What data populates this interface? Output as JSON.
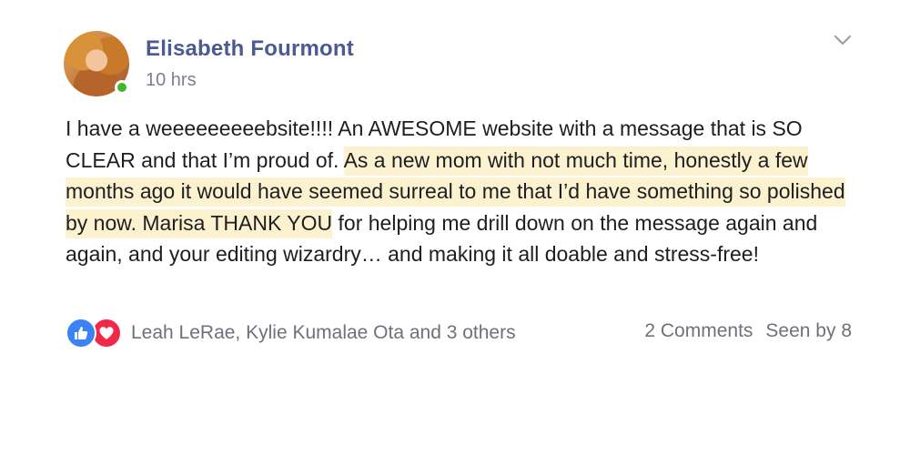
{
  "post": {
    "author": "Elisabeth Fourmont",
    "timestamp": "10 hrs",
    "online": true,
    "text_part1": "I have a weeeeeeeeebsite!!!! An AWESOME website with a message that is SO CLEAR and that I’m proud of. ",
    "text_highlight": "As a new mom with not much time, honestly a few months ago it would have seemed surreal to me that I’d have something so polished by now. Marisa THANK YOU",
    "text_part2": " for helping me drill down on the message again and again, and your editing wizardry… and making it all doable and stress-free!"
  },
  "reactions": {
    "icons": [
      "like-icon",
      "love-icon"
    ],
    "names": "Leah LeRae, Kylie Kumalae Ota and 3 others"
  },
  "meta": {
    "comments": "2 Comments",
    "seen_by": "Seen by 8"
  },
  "colors": {
    "author": "#4b5a8f",
    "highlight": "#fdf2cf",
    "online": "#42b72a",
    "like": "#3b82f6",
    "love": "#f0284a"
  }
}
